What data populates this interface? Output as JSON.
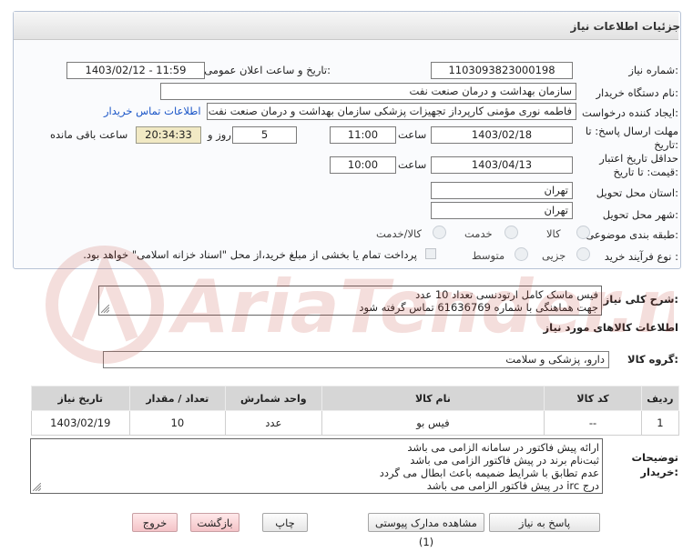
{
  "panel": {
    "title": "جزئیات اطلاعات نیاز"
  },
  "fields": {
    "need_number_label": "شماره نیاز:",
    "need_number": "1103093823000198",
    "announce_label": "تاریخ و ساعت اعلان عمومی:",
    "announce_value": "1403/02/12 - 11:59",
    "buyer_org_label": "نام دستگاه خریدار:",
    "buyer_org": "سازمان بهداشت و درمان صنعت نفت",
    "creator_label": "ایجاد کننده درخواست:",
    "creator": "فاطمه نوری مؤمنی کارپرداز تجهیزات پزشکی سازمان بهداشت و درمان صنعت نفت",
    "buyer_contact_link": "اطلاعات تماس خریدار",
    "reply_deadline_label_1": "مهلت ارسال پاسخ: تا",
    "reply_deadline_label_2": "تاریخ:",
    "reply_date": "1403/02/18",
    "time_label": "ساعت",
    "reply_time": "11:00",
    "days": "5",
    "days_label": "روز و",
    "remaining_time": "20:34:33",
    "remaining_label": "ساعت باقی مانده",
    "validity_label_1": "حداقل تاریخ اعتبار",
    "validity_label_2": "قیمت: تا تاریخ:",
    "validity_date": "1403/04/13",
    "validity_time_label": "ساعت",
    "validity_time": "10:00",
    "province_label": "استان محل تحویل:",
    "province": "تهران",
    "city_label": "شهر محل تحویل:",
    "city": "تهران",
    "category_label": "طبقه بندی موضوعی:",
    "category_options": [
      "کالا",
      "خدمت",
      "کالا/خدمت"
    ],
    "purchase_type_label": "نوع فرآیند خرید :",
    "purchase_options": [
      "جزیی",
      "متوسط"
    ],
    "payment_note": "پرداخت تمام یا بخشی از مبلغ خرید،از محل \"اسناد خزانه اسلامی\" خواهد بود."
  },
  "summary": {
    "label": "شرح کلی نیاز:",
    "lines": [
      "فیس ماسک کامل ارتودنسی تعداد 10 عدد",
      "جهت هماهنگی با شماره 61636769 تماس گرفته شود"
    ]
  },
  "goods": {
    "section_title": "اطلاعات کالاهای مورد نیاز",
    "group_label": "گروه کالا:",
    "group_value": "دارو، پزشکی و سلامت",
    "columns": [
      "ردیف",
      "کد کالا",
      "نام کالا",
      "واحد شمارش",
      "تعداد / مقدار",
      "تاریخ نیاز"
    ],
    "rows": [
      {
        "row": "1",
        "code": "--",
        "name": "فیس بو",
        "unit": "عدد",
        "qty": "10",
        "date": "1403/02/19"
      }
    ]
  },
  "buyer_notes": {
    "label_1": "توضیحات",
    "label_2": "خریدار:",
    "lines": [
      "ارائه پیش فاکتور در سامانه الزامی می باشد",
      "ثبت‌نام برند در پیش فاکتور الزامی می باشد",
      "عدم تطابق با شرایط ضمیمه باعث ابطال می گردد",
      "درج irc در پیش فاکتور الزامی می باشد"
    ]
  },
  "buttons": {
    "reply": "پاسخ به نیاز",
    "attachments": "مشاهده مدارک پیوستی (1)",
    "print": "چاپ",
    "back": "بازگشت",
    "exit": "خروج"
  },
  "watermark": {
    "text": "AriaTender.net"
  }
}
